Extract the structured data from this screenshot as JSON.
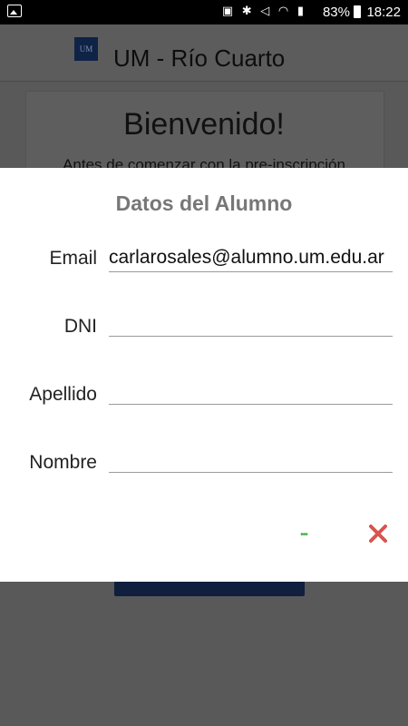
{
  "status_bar": {
    "battery": "83%",
    "time": "18:22",
    "icons": [
      "image-icon",
      "nfc-icon",
      "bluetooth-icon",
      "mute-icon",
      "wifi-icon",
      "signal-icon",
      "battery-icon"
    ]
  },
  "app_bar": {
    "logo_text": "UM",
    "title": "UM - Río Cuarto"
  },
  "background": {
    "heading": "Bienvenido!",
    "text": "Antes de comenzar con la pre-inscripción"
  },
  "dialog": {
    "title": "Datos del Alumno",
    "fields": {
      "email": {
        "label": "Email",
        "value": "carlarosales@alumno.um.edu.ar"
      },
      "dni": {
        "label": "DNI",
        "value": ""
      },
      "apellido": {
        "label": "Apellido",
        "value": ""
      },
      "nombre": {
        "label": "Nombre",
        "value": ""
      }
    },
    "more_label": "•••",
    "colors": {
      "more": "#4caf50",
      "close": "#d9534f"
    }
  }
}
